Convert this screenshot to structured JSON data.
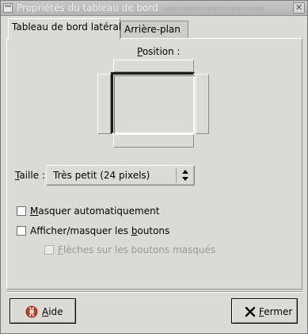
{
  "window": {
    "title": "Propriétés du tableau de bord",
    "close_icon": "close-icon"
  },
  "tabs": [
    {
      "label": "Tableau de bord latéral",
      "active": true
    },
    {
      "label": "Arrière-plan",
      "active": false
    }
  ],
  "position": {
    "label_mnemonic": "P",
    "label_rest": "osition :",
    "selected": "left"
  },
  "size": {
    "label_mnemonic": "T",
    "label_rest": "aille :",
    "value": "Très petit (24 pixels)"
  },
  "options": {
    "autohide": {
      "mnemonic": "M",
      "rest": "asquer automatiquement",
      "checked": false,
      "enabled": true
    },
    "show_buttons": {
      "before": "Afficher/masquer les ",
      "mnemonic": "b",
      "rest": "outons",
      "checked": false,
      "enabled": true
    },
    "arrows": {
      "mnemonic": "F",
      "rest": "lèches sur les boutons masqués",
      "checked": false,
      "enabled": false
    }
  },
  "buttons": {
    "help": {
      "mnemonic": "A",
      "rest": "ide",
      "icon": "help-lifebuoy-icon"
    },
    "close": {
      "mnemonic": "F",
      "rest": "ermer",
      "icon": "close-x-icon"
    }
  },
  "colors": {
    "background": "#dcdad5",
    "disabled_text": "#9a9894",
    "help_icon_red": "#d23a2a"
  }
}
